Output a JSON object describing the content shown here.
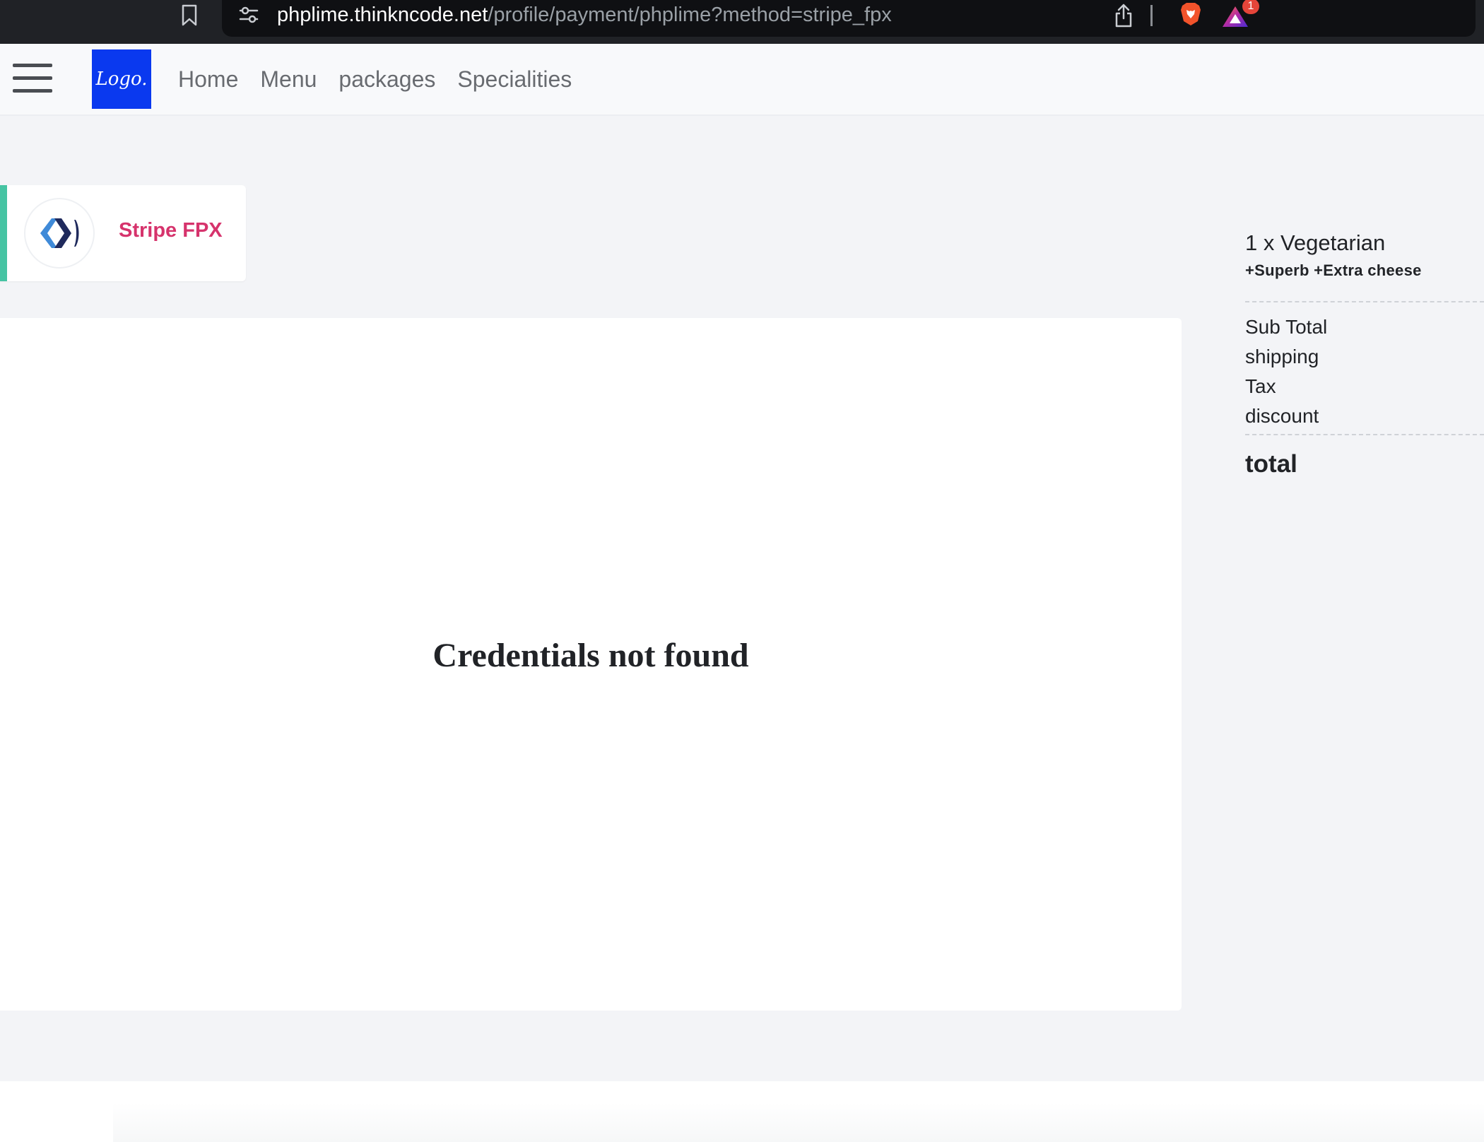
{
  "browser": {
    "url_host": "phplime.thinkncode.net",
    "url_path": "/profile/payment/phplime?method=stripe_fpx",
    "rewards_badge": "1"
  },
  "navbar": {
    "logo_text": "Logo.",
    "links": [
      {
        "label": "Home"
      },
      {
        "label": "Menu"
      },
      {
        "label": "packages"
      },
      {
        "label": "Specialities"
      }
    ]
  },
  "payment": {
    "method_name": "Stripe FPX",
    "error_message": "Credentials not found"
  },
  "order_summary": {
    "item_title": "1 x Vegetarian",
    "item_options": "+Superb +Extra cheese",
    "rows": [
      {
        "label": "Sub Total"
      },
      {
        "label": "shipping"
      },
      {
        "label": "Tax"
      },
      {
        "label": "discount"
      }
    ],
    "total_label": "total"
  },
  "colors": {
    "accent_logo_bg": "#0a39ef",
    "method_name": "#d6336c",
    "active_tab_border": "#46c4a3"
  },
  "icons": [
    "bookmark-icon",
    "site-settings-icon",
    "share-icon",
    "brave-shield-icon",
    "brave-rewards-icon",
    "hamburger-icon",
    "fpx-logo-icon"
  ]
}
